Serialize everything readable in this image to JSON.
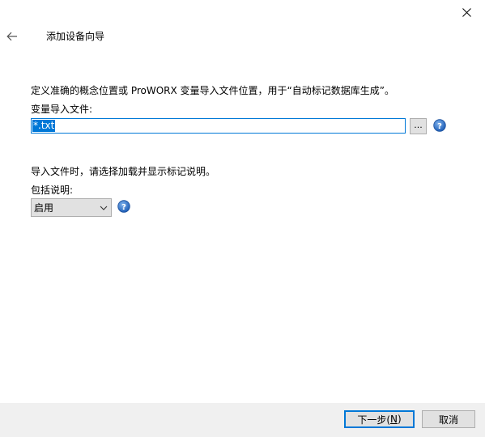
{
  "window": {
    "close_icon": "close-icon"
  },
  "header": {
    "back_icon": "back-arrow-icon",
    "title": "添加设备向导"
  },
  "main": {
    "description": "定义准确的概念位置或 ProWORX 变量导入文件位置，用于“自动标记数据库生成”。",
    "file_label": "变量导入文件:",
    "file_value": "*.txt",
    "browse_label": "...",
    "help_icon": "help-icon",
    "import_note": "导入文件时，请选择加载并显示标记说明。",
    "include_label": "包括说明:",
    "include_selected": "启用"
  },
  "footer": {
    "next_text": "下一步(",
    "next_key": "N",
    "next_close": ")",
    "cancel_label": "取消"
  },
  "colors": {
    "accent": "#0078d7",
    "footer_bg": "#f0f0f0",
    "button_bg": "#e1e1e1"
  }
}
